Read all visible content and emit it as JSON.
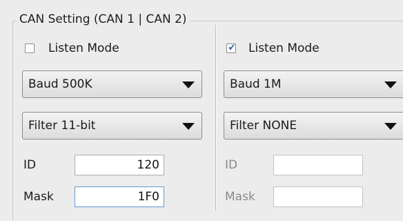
{
  "group": {
    "title": "CAN Setting  (CAN 1 | CAN 2)"
  },
  "can1": {
    "listen_mode": {
      "label": "Listen Mode",
      "checked": false
    },
    "baud": {
      "selected": "Baud 500K"
    },
    "filter": {
      "selected": "Filter 11-bit"
    },
    "id": {
      "label": "ID",
      "value": "120"
    },
    "mask": {
      "label": "Mask",
      "value": "1F0"
    }
  },
  "can2": {
    "listen_mode": {
      "label": "Listen Mode",
      "checked": true
    },
    "baud": {
      "selected": "Baud 1M"
    },
    "filter": {
      "selected": "Filter NONE"
    },
    "id": {
      "label": "ID",
      "value": ""
    },
    "mask": {
      "label": "Mask",
      "value": ""
    }
  },
  "colors": {
    "check_tick": "#2b5aa8",
    "focus_border": "#5b9bd5",
    "disabled_text": "#8a8a8a"
  }
}
